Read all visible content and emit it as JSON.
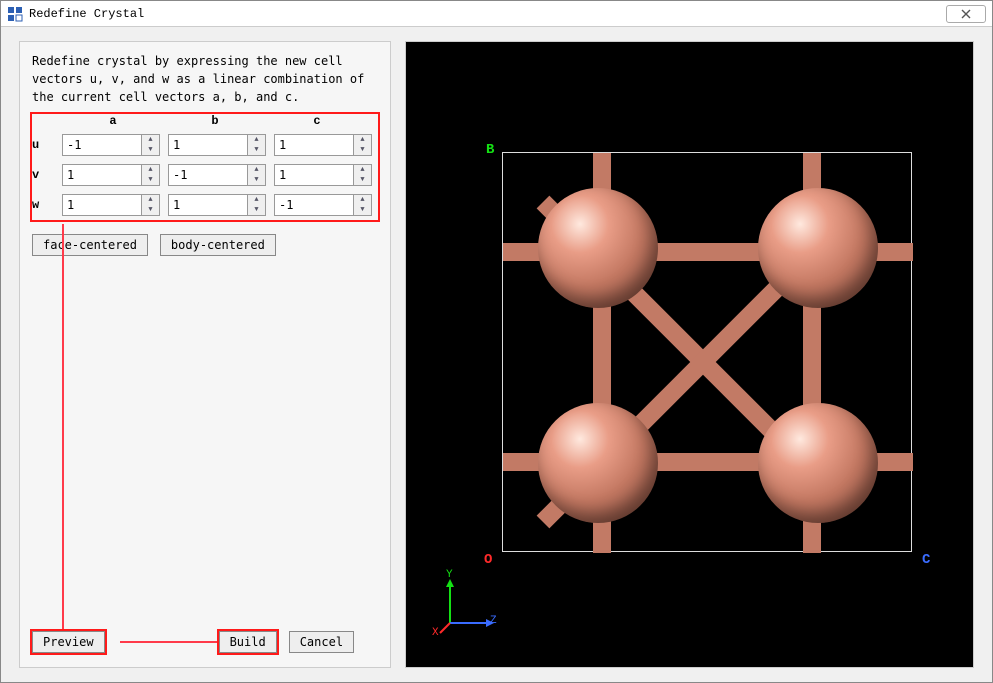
{
  "window": {
    "title": "Redefine Crystal"
  },
  "description": "Redefine crystal by expressing the new  cell vectors u, v, and w as a linear combination of the current cell vectors a, b, and c.",
  "matrix": {
    "col_headers": [
      "a",
      "b",
      "c"
    ],
    "rows": [
      {
        "label": "u",
        "values": [
          "-1",
          "1",
          "1"
        ]
      },
      {
        "label": "v",
        "values": [
          "1",
          "-1",
          "1"
        ]
      },
      {
        "label": "w",
        "values": [
          "1",
          "1",
          "-1"
        ]
      }
    ]
  },
  "preset_buttons": {
    "face_centered": "face-centered",
    "body_centered": "body-centered"
  },
  "action_buttons": {
    "preview": "Preview",
    "build": "Build",
    "cancel": "Cancel"
  },
  "viewer": {
    "axis_labels": {
      "b": "B",
      "c": "C",
      "origin": "O"
    },
    "coord_labels": {
      "y": "Y",
      "z": "Z",
      "x": "X"
    }
  }
}
